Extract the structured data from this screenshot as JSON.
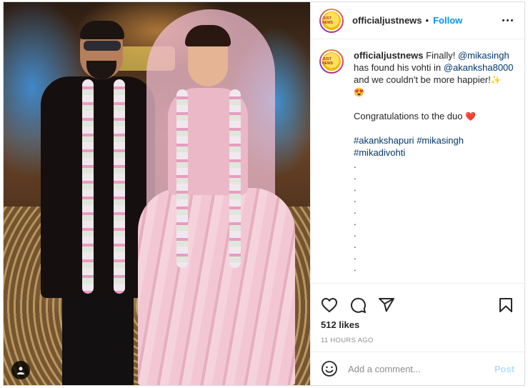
{
  "post": {
    "username": "officialjustnews",
    "avatar_text": "JUST NEWS",
    "follow_label": "Follow",
    "separator": "•"
  },
  "caption": {
    "username": "officialjustnews",
    "line1_prefix": "Finally! ",
    "mention1": "@mikasingh",
    "line2_prefix": "has found his vohti in ",
    "mention2": "@akanksha8000",
    "line3": "and we couldn't be more happier!",
    "emoji_sparkles": "✨",
    "emoji_heart_eyes": "😍",
    "congrats": "Congratulations to the duo",
    "emoji_heart": "❤️",
    "hashtags": [
      "#akankshapuri",
      "#mikasingh",
      "#mikadivohti"
    ],
    "dots": [
      ".",
      ".",
      ".",
      ".",
      ".",
      ".",
      ".",
      ".",
      ".",
      "."
    ]
  },
  "icons": {
    "like": "heart-icon",
    "comment": "comment-icon",
    "share": "share-icon",
    "save": "bookmark-icon",
    "more": "more-options-icon",
    "emoji": "smiley-icon",
    "tagged_user": "user-icon"
  },
  "likes": "512 likes",
  "timestamp": "11 HOURS AGO",
  "comment": {
    "placeholder": "Add a comment...",
    "post_label": "Post"
  },
  "colors": {
    "link_blue": "#0095f6",
    "mention_blue": "#00376b",
    "post_disabled": "#b2dffc",
    "muted_gray": "#8e8e8e"
  }
}
